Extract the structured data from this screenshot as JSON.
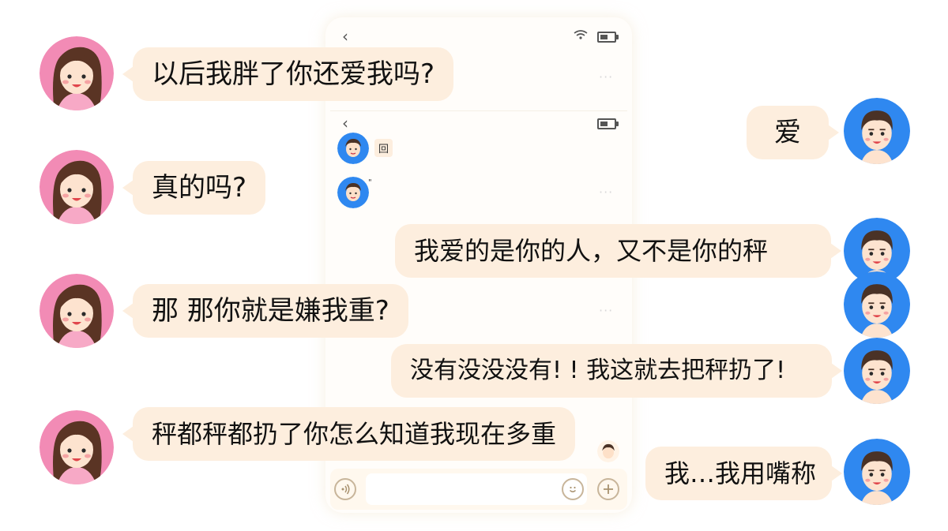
{
  "chat": {
    "messages": [
      {
        "side": "left",
        "text": "以后我胖了你还爱我吗?"
      },
      {
        "side": "right",
        "text": "爱"
      },
      {
        "side": "left",
        "text": "真的吗?"
      },
      {
        "side": "right",
        "text": "我爱的是你的人，又不是你的秤"
      },
      {
        "side": "left",
        "text": "那 那你就是嫌我重?"
      },
      {
        "side": "right",
        "text": "没有没没没有! ! 我这就去把秤扔了!"
      },
      {
        "side": "left",
        "text": "秤都秤都扔了你怎么知道我现在多重"
      },
      {
        "side": "right",
        "text": "我…我用嘴称"
      }
    ]
  },
  "phone_bg": {
    "back_icon": "‹",
    "more_icon": "···",
    "mini_reply_text": "回",
    "mini_quote_text": "\""
  },
  "icons": {
    "voice": "voice-icon",
    "emoji": "emoji-icon",
    "plus": "plus-icon"
  },
  "colors": {
    "bubble": "#fdeede",
    "her_avatar_bg": "#f28bb5",
    "his_avatar_bg": "#2f88f0",
    "input_bar": "#fff8ee"
  }
}
